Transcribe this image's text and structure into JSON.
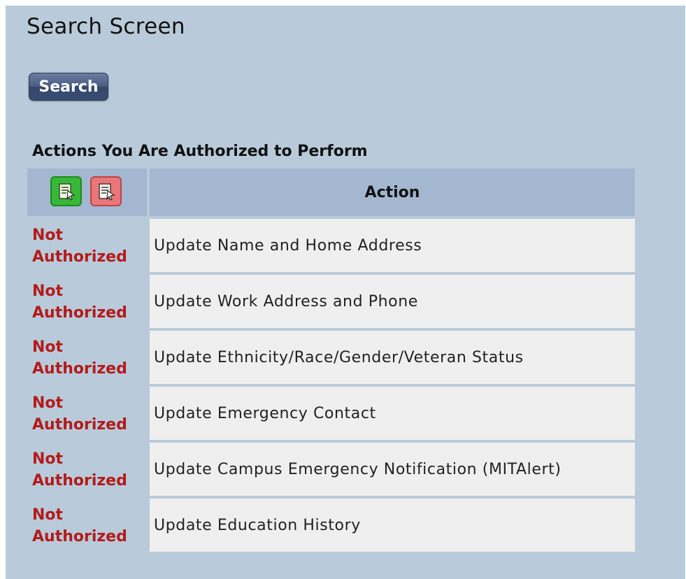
{
  "page": {
    "title": "Search Screen"
  },
  "search_button": {
    "label": "Search"
  },
  "actions_section": {
    "heading": "Actions You Are Authorized to Perform",
    "column_header": "Action",
    "header_icons": [
      "select-all-icon",
      "deselect-all-icon"
    ],
    "rows": [
      {
        "status": "Not Authorized",
        "action": "Update Name and Home Address"
      },
      {
        "status": "Not Authorized",
        "action": "Update Work Address and Phone"
      },
      {
        "status": "Not Authorized",
        "action": "Update Ethnicity/Race/Gender/Veteran Status"
      },
      {
        "status": "Not Authorized",
        "action": "Update Emergency Contact"
      },
      {
        "status": "Not Authorized",
        "action": "Update Campus Emergency Notification (MITAlert)"
      },
      {
        "status": "Not Authorized",
        "action": "Update Education History"
      }
    ]
  },
  "colors": {
    "panel_background": "#b9cbda",
    "table_header_background": "#a3b8d0",
    "row_background": "#efefef",
    "not_authorized_text": "#b31b1b",
    "button_background": "#4a5d82",
    "green_icon": "#37b838",
    "red_icon": "#e97678"
  }
}
